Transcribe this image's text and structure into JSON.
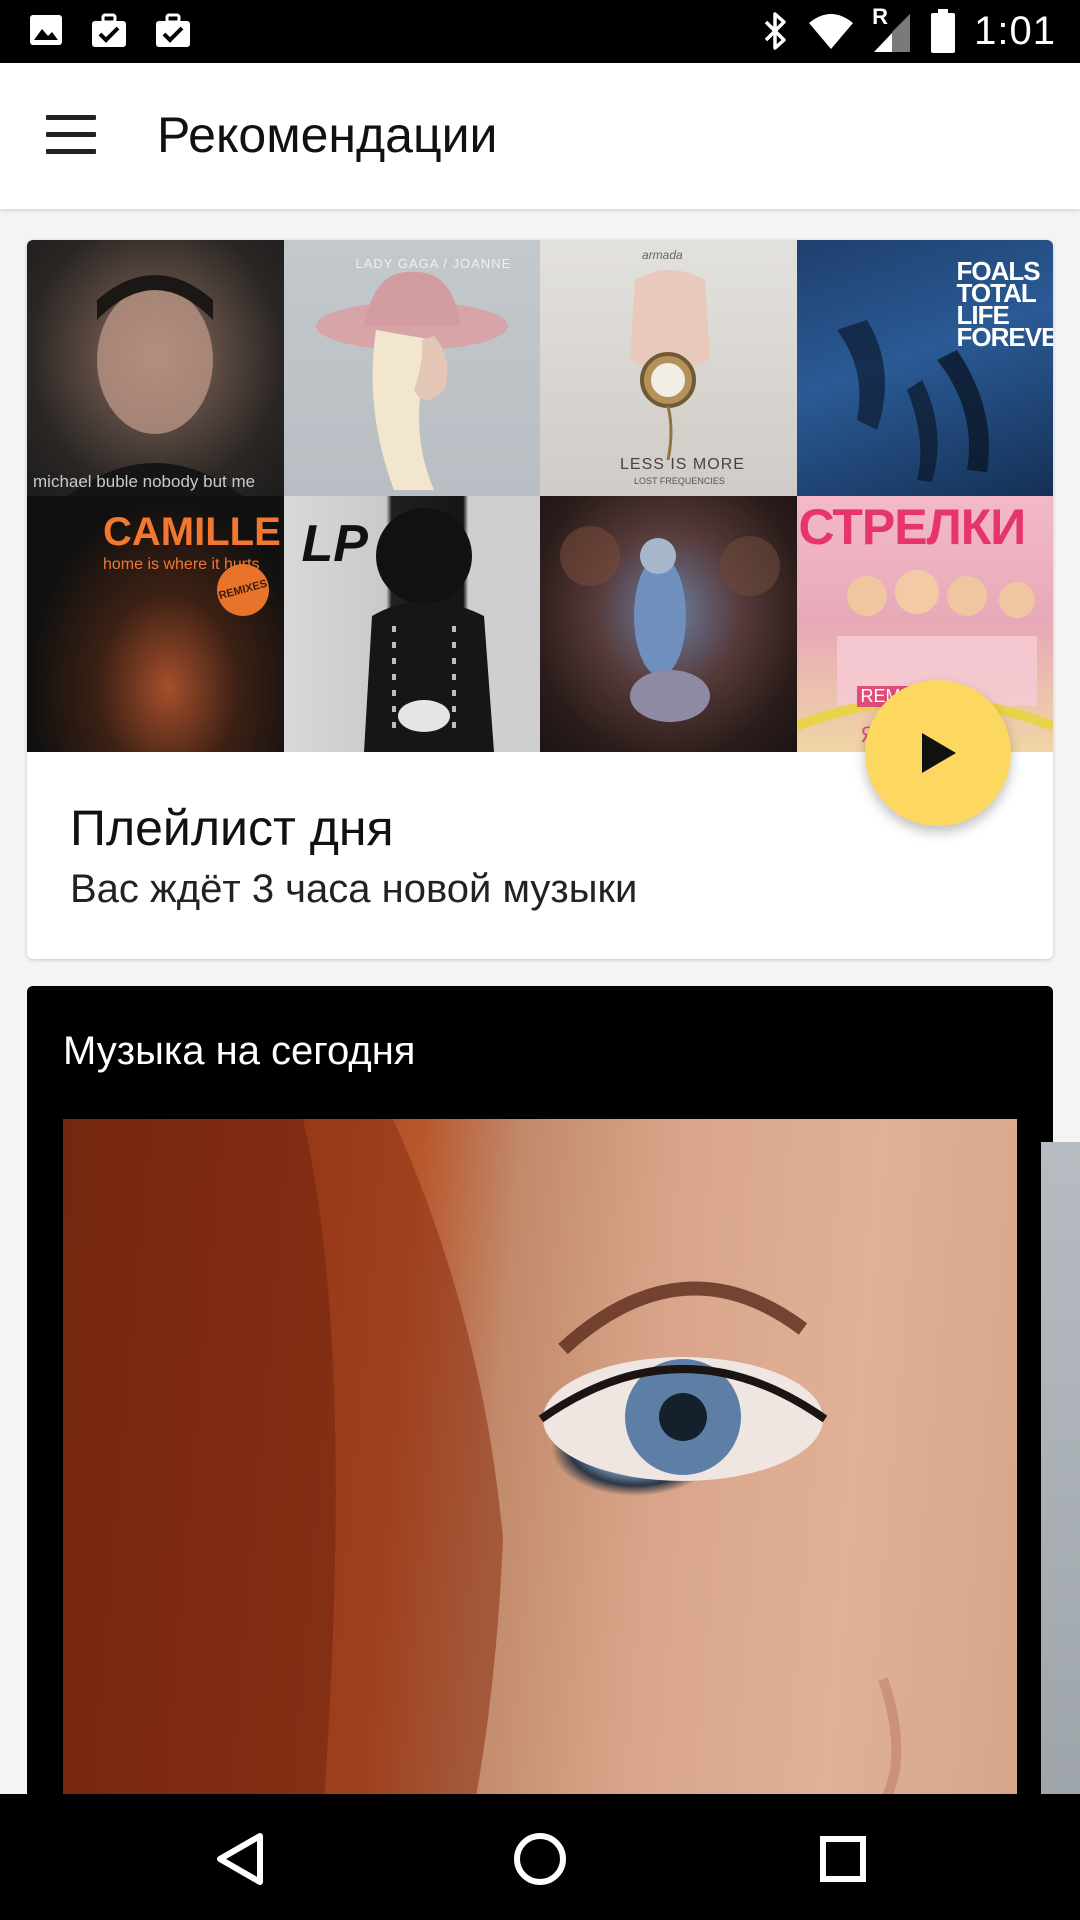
{
  "status_bar": {
    "time": "1:01",
    "icons_left": [
      "image-icon",
      "briefcase-check-icon",
      "briefcase-check-icon"
    ],
    "icons_right": [
      "bluetooth-icon",
      "wifi-icon",
      "signal-roaming-icon",
      "battery-icon"
    ],
    "roaming_label": "R"
  },
  "app_bar": {
    "title": "Рекомендации",
    "menu_icon": "hamburger-menu-icon"
  },
  "playlist_card": {
    "title": "Плейлист дня",
    "subtitle": "Вас ждёт 3 часа новой музыки",
    "play_icon": "play-icon",
    "fab_color": "#fcd860",
    "covers": [
      {
        "text": "michael buble nobody but me"
      },
      {
        "text": "LADY GAGA / JOANNE"
      },
      {
        "text": "LESS IS MORE",
        "subtext": "LOST FREQUENCIES",
        "top": "armada"
      },
      {
        "text": "FOALS TOTAL LIFE FOREVER"
      },
      {
        "text": "CAMILLE",
        "subtext": "home is where it hurts",
        "badge": "REMIXES"
      },
      {
        "text": "LP"
      },
      {
        "text": ""
      },
      {
        "text": "СТРЕЛКИ",
        "subtext": "REMIX",
        "bottom": "Я ХО"
      }
    ]
  },
  "today_card": {
    "title": "Музыка на сегодня"
  },
  "nav_bar": {
    "back_icon": "back-triangle-icon",
    "home_icon": "home-circle-icon",
    "recents_icon": "recents-square-icon"
  }
}
